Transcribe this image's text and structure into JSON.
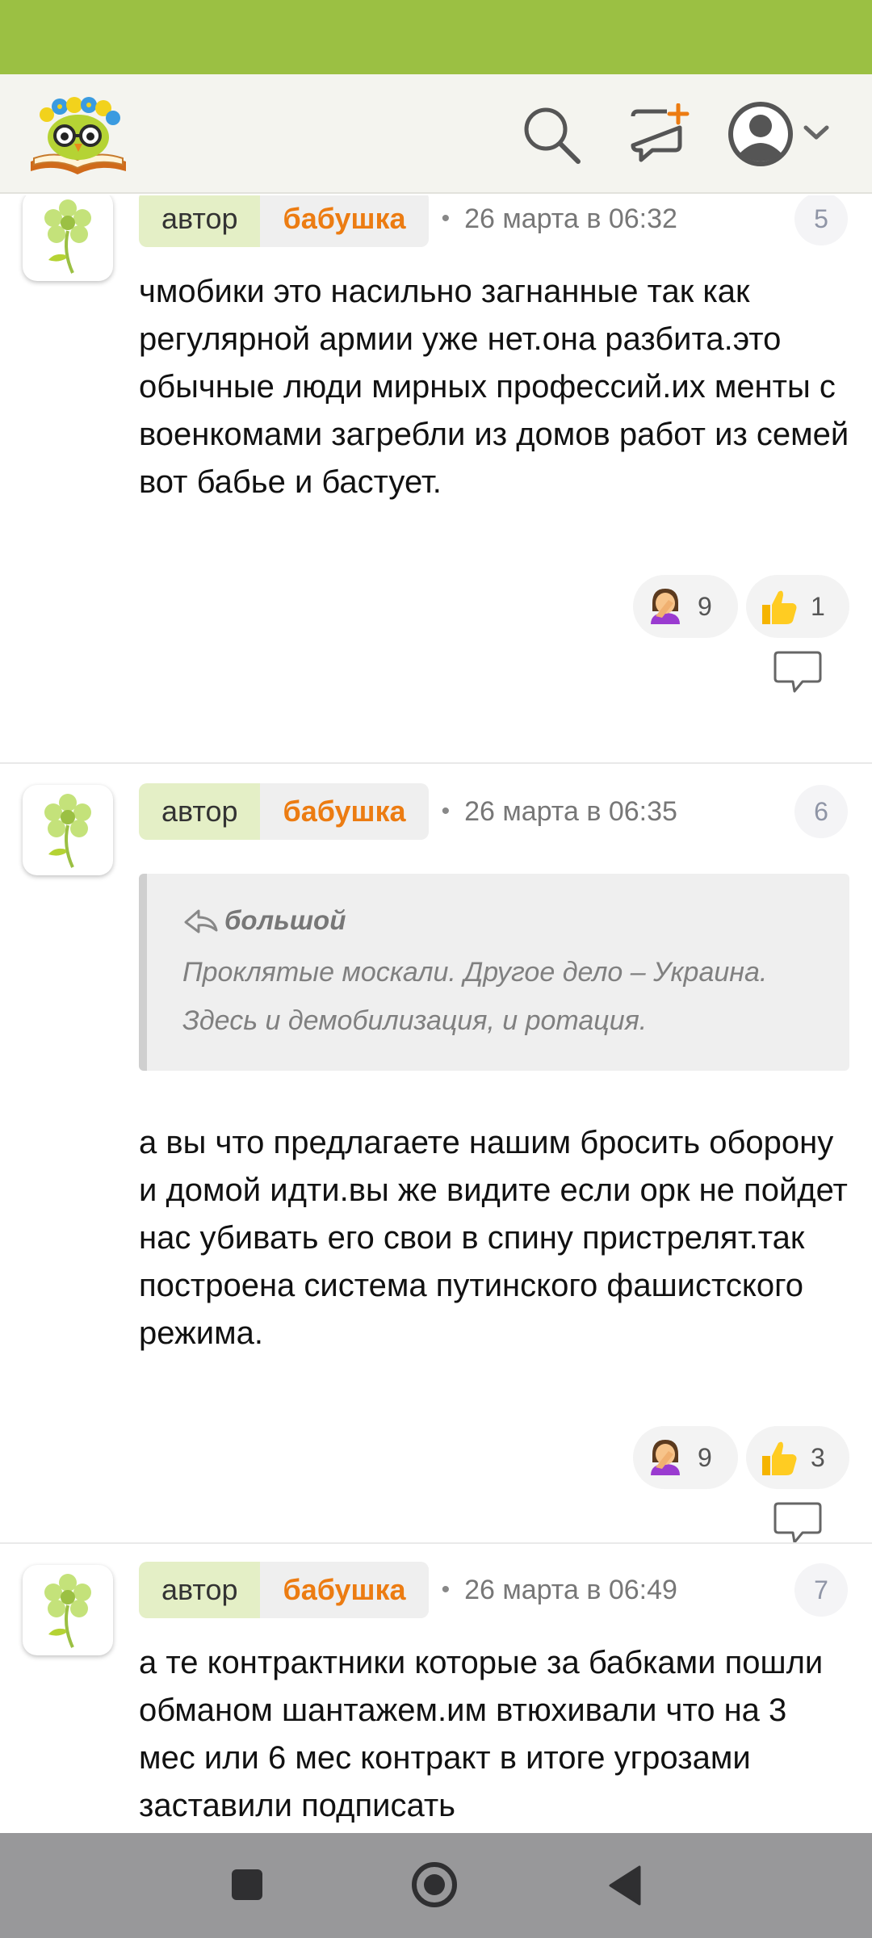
{
  "colors": {
    "status_bar": "#9bc043",
    "accent_user": "#ec7c12",
    "author_tag": "#e4efc6",
    "nav_bar": "#98989a"
  },
  "header": {
    "logo": "owl-on-book-logo",
    "icons": [
      "search-icon",
      "new-post-icon",
      "profile-icon",
      "chevron-down-icon"
    ]
  },
  "comments": [
    {
      "author_tag": "автор",
      "user": "бабушка",
      "dot": "•",
      "time": "26 марта в 06:32",
      "number": "5",
      "text": "чмобики это насильно загнанные так как регулярной армии уже нет.она разбита.это обычные люди мирных профессий.их менты с военкомами загребли из домов работ из семей вот бабье и бастует.",
      "reactions": [
        {
          "icon": "facepalm-emoji",
          "count": "9"
        },
        {
          "icon": "thumbs-up-emoji",
          "count": "1"
        }
      ]
    },
    {
      "author_tag": "автор",
      "user": "бабушка",
      "dot": "•",
      "time": "26 марта в 06:35",
      "number": "6",
      "quote": {
        "author": "большой",
        "text": "Проклятые москали. Другое дело – Украина. Здесь и демобилизация, и ротация."
      },
      "text": "а вы что предлагаете нашим бросить оборону и домой идти.вы же видите если орк не пойдет нас убивать его свои в спину пристрелят.так построена система путинского фашистского режима.",
      "reactions": [
        {
          "icon": "facepalm-emoji",
          "count": "9"
        },
        {
          "icon": "thumbs-up-emoji",
          "count": "3"
        }
      ]
    },
    {
      "author_tag": "автор",
      "user": "бабушка",
      "dot": "•",
      "time": "26 марта в 06:49",
      "number": "7",
      "text": "а те контрактники которые за бабками пошли обманом шантажем.им втюхивали что на 3 мес или 6 мес контракт в итоге угрозами заставили подписать"
    }
  ],
  "nav": {
    "icons": [
      "recents-square-icon",
      "home-circle-icon",
      "back-triangle-icon"
    ]
  }
}
